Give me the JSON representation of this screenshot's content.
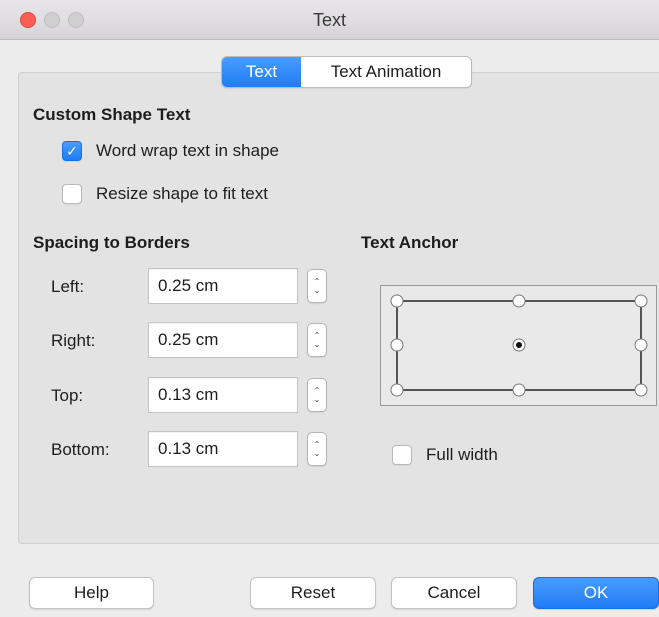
{
  "window": {
    "title": "Text"
  },
  "tabs": [
    {
      "label": "Text",
      "active": true
    },
    {
      "label": "Text Animation",
      "active": false
    }
  ],
  "custom_shape_text": {
    "heading": "Custom Shape Text",
    "word_wrap": {
      "label": "Word wrap text in shape",
      "checked": true
    },
    "resize_shape": {
      "label": "Resize shape to fit text",
      "checked": false
    }
  },
  "spacing": {
    "heading": "Spacing to Borders",
    "left": {
      "label": "Left:",
      "value": "0.25 cm"
    },
    "right": {
      "label": "Right:",
      "value": "0.25 cm"
    },
    "top": {
      "label": "Top:",
      "value": "0.13 cm"
    },
    "bottom": {
      "label": "Bottom:",
      "value": "0.13 cm"
    }
  },
  "anchor": {
    "heading": "Text Anchor",
    "selected": "center",
    "full_width": {
      "label": "Full width",
      "checked": false
    }
  },
  "buttons": {
    "help": "Help",
    "reset": "Reset",
    "cancel": "Cancel",
    "ok": "OK"
  },
  "colors": {
    "accent": "#1f7cf4",
    "close": "#fd5f57"
  }
}
